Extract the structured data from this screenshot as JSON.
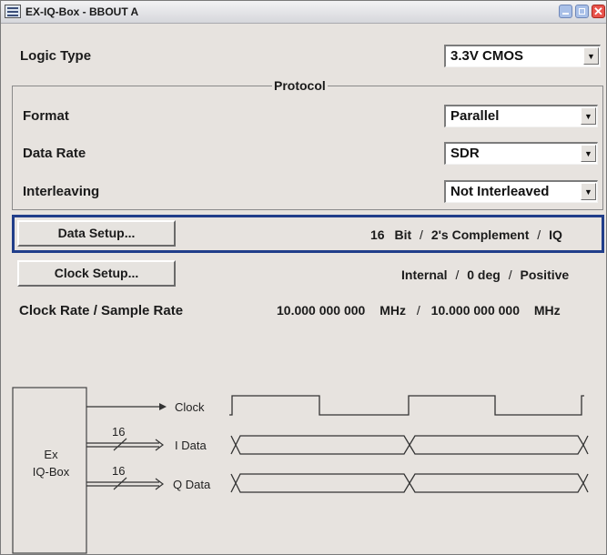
{
  "window": {
    "title": "EX-IQ-Box - BBOUT A",
    "close_glyph": "✕"
  },
  "logic_type": {
    "label": "Logic Type",
    "value": "3.3V CMOS"
  },
  "protocol": {
    "title": "Protocol",
    "format": {
      "label": "Format",
      "value": "Parallel"
    },
    "data_rate": {
      "label": "Data Rate",
      "value": "SDR"
    },
    "interleaving": {
      "label": "Interleaving",
      "value": "Not Interleaved"
    }
  },
  "data_setup": {
    "button_label": "Data Setup...",
    "bits": "16",
    "bit_unit": "Bit",
    "coding": "2's Complement",
    "mode": "IQ",
    "separator": "/"
  },
  "clock_setup": {
    "button_label": "Clock Setup...",
    "source": "Internal",
    "phase": "0 deg",
    "edge": "Positive",
    "separator": "/"
  },
  "rates": {
    "label": "Clock Rate / Sample Rate",
    "clock_rate": "10.000 000 000",
    "clock_unit": "MHz",
    "separator": "/",
    "sample_rate": "10.000 000 000",
    "sample_unit": "MHz"
  },
  "diagram": {
    "box_line1": "Ex",
    "box_line2": "IQ-Box",
    "clock_label": "Clock",
    "i_label": "I Data",
    "q_label": "Q Data",
    "i_bus_width": "16",
    "q_bus_width": "16"
  },
  "icons": {
    "dropdown_arrow": "▼",
    "app": "app-window-icon",
    "minimize": "minimize-icon",
    "maximize": "maximize-icon",
    "close": "close-icon"
  },
  "colors": {
    "window_bg": "#e7e3df",
    "focus_border": "#213e8a",
    "close_button": "#e8534c"
  }
}
